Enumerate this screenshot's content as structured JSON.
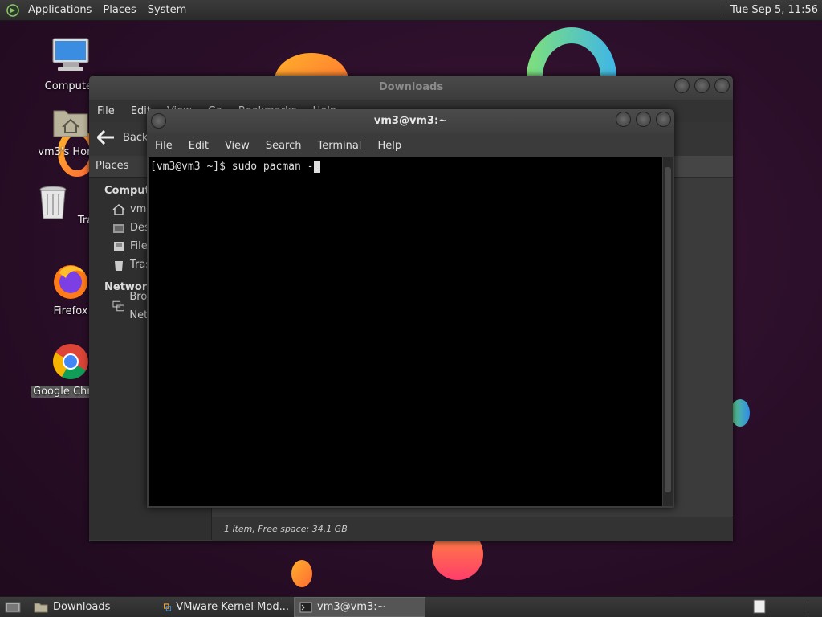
{
  "top_panel": {
    "menus": [
      "Applications",
      "Places",
      "System"
    ],
    "clock": "Tue Sep  5, 11:56"
  },
  "desktop": {
    "icons": [
      {
        "label": "Computer"
      },
      {
        "label": "vm3's Home"
      },
      {
        "label": "Trash"
      },
      {
        "label": "Firefox"
      },
      {
        "label": "Google Chrome"
      }
    ]
  },
  "file_manager": {
    "title": "Downloads",
    "menu": [
      "File",
      "Edit",
      "View",
      "Go",
      "Bookmarks",
      "Help"
    ],
    "back_label": "Back",
    "sidebar_header": "Places",
    "sections": [
      {
        "heading": "Computer",
        "items": [
          "vm3",
          "Desktop",
          "File System",
          "Trash"
        ]
      },
      {
        "heading": "Network",
        "items": [
          "Browse Network"
        ]
      }
    ],
    "status": "1 item, Free space: 34.1 GB"
  },
  "terminal": {
    "title": "vm3@vm3:~",
    "menu": [
      "File",
      "Edit",
      "View",
      "Search",
      "Terminal",
      "Help"
    ],
    "prompt_line": "[vm3@vm3 ~]$ sudo pacman -"
  },
  "taskbar": {
    "tasks": [
      "Downloads",
      "VMware Kernel Mod...",
      "vm3@vm3:~"
    ]
  },
  "colors": {
    "desktop_bg": "#2c0f2a",
    "terminal_bg": "#000000",
    "panel_bg": "#2b2b2b"
  }
}
